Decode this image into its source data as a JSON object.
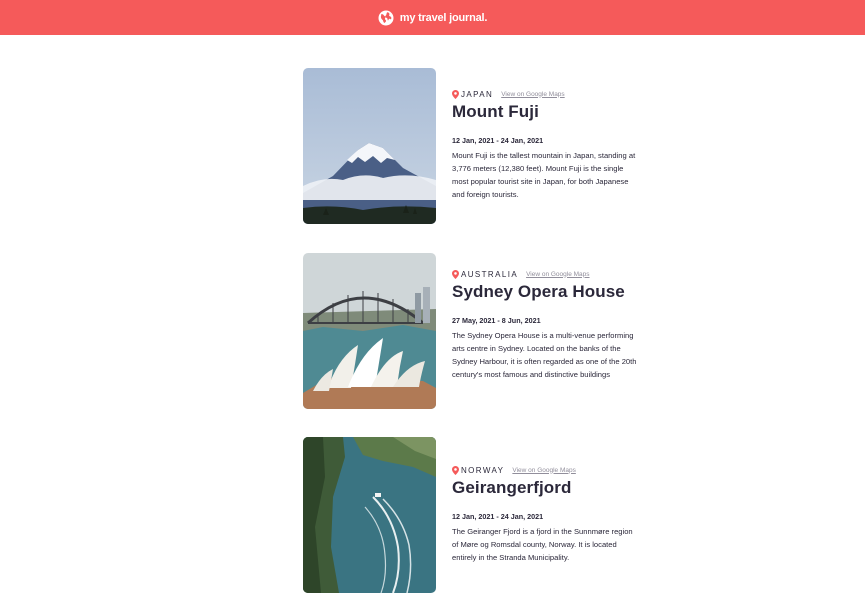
{
  "header": {
    "title": "my travel journal.",
    "icon": "globe-icon"
  },
  "colors": {
    "header_bg": "#f55a5a",
    "pin": "#f55a5a",
    "text": "#2b283a",
    "link": "#918e9b"
  },
  "entries": [
    {
      "country": "JAPAN",
      "maps_link": "View on Google Maps",
      "title": "Mount Fuji",
      "dates": "12 Jan, 2021 - 24 Jan, 2021",
      "description": "Mount Fuji is the tallest mountain in Japan, standing at 3,776 meters (12,380 feet). Mount Fuji is the single most popular tourist site in Japan, for both Japanese and foreign tourists."
    },
    {
      "country": "AUSTRALIA",
      "maps_link": "View on Google Maps",
      "title": "Sydney Opera House",
      "dates": "27 May, 2021 - 8 Jun, 2021",
      "description": "The Sydney Opera House is a multi-venue performing arts centre in Sydney. Located on the banks of the Sydney Harbour, it is often regarded as one of the 20th century's most famous and distinctive buildings"
    },
    {
      "country": "NORWAY",
      "maps_link": "View on Google Maps",
      "title": "Geirangerfjord",
      "dates": "12 Jan, 2021 - 24 Jan, 2021",
      "description": "The Geiranger Fjord is a fjord in the Sunnmøre region of Møre og Romsdal county, Norway. It is located entirely in the Stranda Municipality."
    }
  ]
}
